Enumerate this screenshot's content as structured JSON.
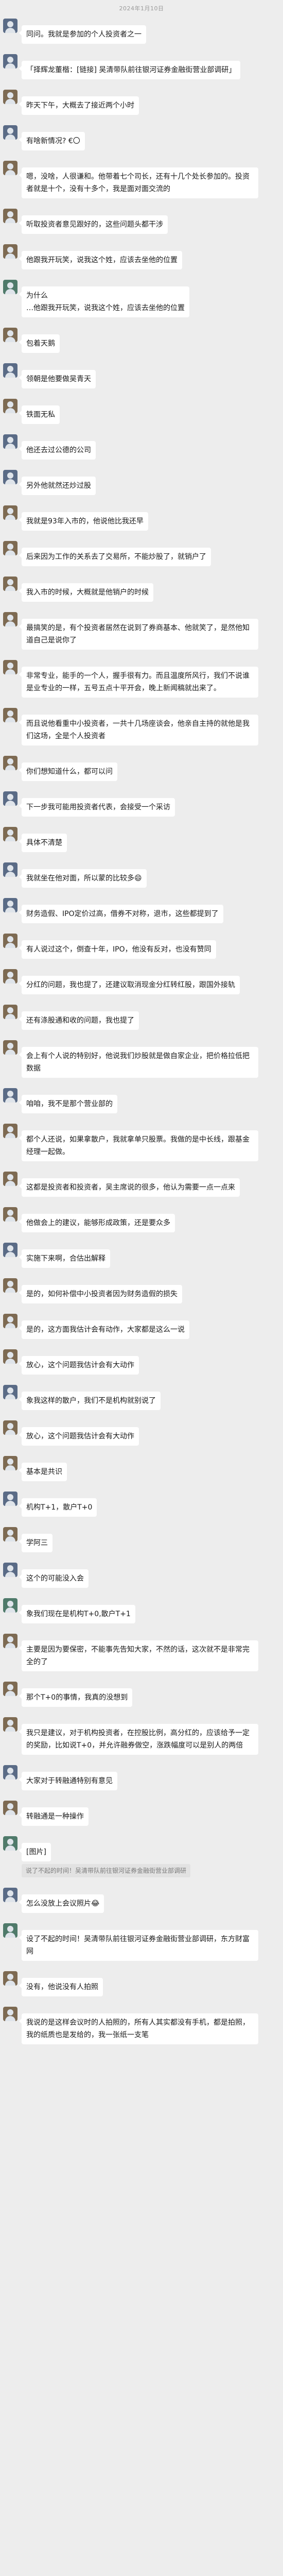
{
  "timestamp": "2024年1月10日",
  "messages": [
    {
      "avatar": "a",
      "text": "同问。我就是参加的个人投资者之一"
    },
    {
      "avatar": "a",
      "text": "「择辉龙董楷：[链接] 吴清带队前往银河证券金融街营业部调研」"
    },
    {
      "avatar": "b",
      "text": "昨天下午，大概去了接近两个小时"
    },
    {
      "avatar": "a",
      "text": "有啥新情况? €〇"
    },
    {
      "avatar": "b",
      "text": "嗯，没啥，人很谦和。他带着七个司长，还有十几个处长参加的。投资者就是十个，没有十多个，我是面对面交流的"
    },
    {
      "avatar": "b",
      "text": "听取投资者意见跟好的，这些问题头都干涉"
    },
    {
      "avatar": "b",
      "text": "他跟我开玩笑，说我这个姓，应该去坐他的位置"
    },
    {
      "avatar": "c",
      "text": "为什么\n…他跟我开玩笑，说我这个姓，应该去坐他的位置"
    },
    {
      "avatar": "b",
      "text": "包着天鹅"
    },
    {
      "avatar": "a",
      "text": "领朝是他要做吴青天"
    },
    {
      "avatar": "b",
      "text": "铁面无私"
    },
    {
      "avatar": "a",
      "text": "他还去过公德的公司"
    },
    {
      "avatar": "a",
      "text": "另外他就然还炒过股"
    },
    {
      "avatar": "b",
      "text": "我就是93年入市的，他说他比我还早"
    },
    {
      "avatar": "b",
      "text": "后来因为工作的关系去了交易所，不能炒股了，就销户了"
    },
    {
      "avatar": "b",
      "text": "我入市的时候，大概就是他销户的时候"
    },
    {
      "avatar": "b",
      "text": "最搞笑的是，有个投资者居然在说到了券商基本、他就笑了，是然他知道自己是说你了"
    },
    {
      "avatar": "b",
      "text": "非常专业，能手的一个人，握手很有力。而且温度所风行，我们不说谁是业专业的一样，五号五点十平开会，晚上新闻稿就出来了。"
    },
    {
      "avatar": "b",
      "text": "而且说他看重中小投资者，一共十几场座谈会，他亲自主持的就他是我们这场，全是个人投资者"
    },
    {
      "avatar": "b",
      "text": "你们想知道什么，都可以问"
    },
    {
      "avatar": "a",
      "text": "下一步我可能用投资者代表，会接受一个采访"
    },
    {
      "avatar": "b",
      "text": "具体不清楚"
    },
    {
      "avatar": "a",
      "text": "我就坐在他对面，所以蒙的比较多😄"
    },
    {
      "avatar": "a",
      "text": "财务造假、IPO定价过高，借券不对称，退市，这些都提到了"
    },
    {
      "avatar": "b",
      "text": "有人说过这个，倒查十年，IPO，他没有反对，也没有赞同"
    },
    {
      "avatar": "b",
      "text": "分红的问题，我也提了，还建议取消现金分红转红股，跟国外接轨"
    },
    {
      "avatar": "b",
      "text": "还有涤股通和收的问题，我也提了"
    },
    {
      "avatar": "b",
      "text": "会上有个人说的特别好，他说我们炒股就是做自家企业，把价格拉低把数据"
    },
    {
      "avatar": "a",
      "text": "咱咱，我不是那个营业部的"
    },
    {
      "avatar": "b",
      "text": "都个人还说，如果拿散户，我就拿单只股票。我做的是中长线，跟基金经理一起做。"
    },
    {
      "avatar": "b",
      "text": "这都是投资者和投资者，吴主席说的很多，他认为需要一点一点来"
    },
    {
      "avatar": "b",
      "text": "他做会上的建议，能够形成政策，还是要众多"
    },
    {
      "avatar": "a",
      "text": "实施下来啊，合估出解释"
    },
    {
      "avatar": "b",
      "text": "是的，如何补偿中小投资者因为财务造假的损失"
    },
    {
      "avatar": "b",
      "text": "是的，这方面我估计会有动作，大家都是这么一说"
    },
    {
      "avatar": "b",
      "text": "放心，这个问题我估计会有大动作"
    },
    {
      "avatar": "a",
      "text": "象我这样的散户，我们不是机构就别说了"
    },
    {
      "avatar": "b",
      "text": "放心，这个问题我估计会有大动作"
    },
    {
      "avatar": "b",
      "text": "基本是共识"
    },
    {
      "avatar": "a",
      "text": "机构T+1，散户T+0"
    },
    {
      "avatar": "b",
      "text": "学阿三"
    },
    {
      "avatar": "a",
      "text": "这个的可能没入会"
    },
    {
      "avatar": "c",
      "text": "象我们现在是机构T+0,散户T+1"
    },
    {
      "avatar": "b",
      "text": "主要是因为要保密，不能事先告知大家，不然的话，这次就不是非常完全的了"
    },
    {
      "avatar": "b",
      "text": "那个T+0的事情，我真的没想到"
    },
    {
      "avatar": "b",
      "text": "我只是建议，对于机构投资者，在控股比例，高分红的，应该给予一定的奖励，比如说T+0，并允许融券做空，涨跌幅度可以是别人的两倍"
    },
    {
      "avatar": "a",
      "text": "大家对于转融通特别有意见"
    },
    {
      "avatar": "b",
      "text": "转融通是一种操作"
    },
    {
      "avatar": "c",
      "text": "[图片]",
      "quote": "说了不起的时间！吴清带队前往银河证券金融街营业部调研"
    },
    {
      "avatar": "a",
      "text": "怎么没放上会议照片😂"
    },
    {
      "avatar": "c",
      "text": "设了不起的时间！吴清带队前往银河证券金融街营业部调研，东方财富网"
    },
    {
      "avatar": "b",
      "text": "没有，他说没有人拍照"
    },
    {
      "avatar": "b",
      "text": "我说的是这样会议时的人拍照的，所有人其实都没有手机，都是拍照，我的纸质也是发给的，我一张纸一支笔"
    }
  ]
}
